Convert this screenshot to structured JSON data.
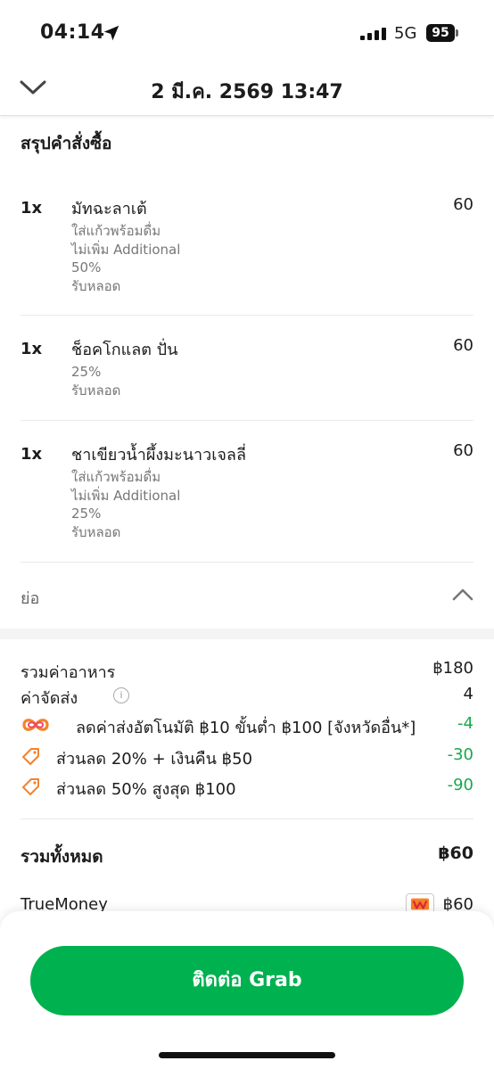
{
  "status_bar": {
    "time": "04:14",
    "network": "5G",
    "battery": "95"
  },
  "header": {
    "title": "2 มี.ค. 2569 13:47"
  },
  "summary": {
    "title": "สรุปคำสั่งซื้อ",
    "items": [
      {
        "qty": "1x",
        "name": "มัทฉะลาเต้",
        "price": "60",
        "options": [
          "ใส่แก้วพร้อมดื่ม",
          "ไม่เพิ่ม Additional",
          "50%",
          "รับหลอด"
        ]
      },
      {
        "qty": "1x",
        "name": "ช็อคโกแลต ปั่น",
        "price": "60",
        "options": [
          "25%",
          "รับหลอด"
        ]
      },
      {
        "qty": "1x",
        "name": "ชาเขียวน้ำผึ้งมะนาวเจลลี่",
        "price": "60",
        "options": [
          "ใส่แก้วพร้อมดื่ม",
          "ไม่เพิ่ม Additional",
          "25%",
          "รับหลอด"
        ]
      }
    ],
    "collapse_label": "ย่อ"
  },
  "costs": {
    "food_label": "รวมค่าอาหาร",
    "food_value": "฿180",
    "delivery_label": "ค่าจัดส่ง",
    "info_glyph": "i",
    "delivery_value": "4",
    "discounts": [
      {
        "label": "ลดค่าส่งอัตโนมัติ ฿10 ขั้นต่ำ ฿100 [จังหวัดอื่น*]",
        "value": "-4",
        "icon": "loop-promo-icon"
      },
      {
        "label": "ส่วนลด 20% + เงินคืน ฿50",
        "value": "-30",
        "icon": "discount-tag-icon"
      },
      {
        "label": "ส่วนลด 50% สูงสุด ฿100",
        "value": "-90",
        "icon": "discount-tag-icon"
      }
    ],
    "total_label": "รวมทั้งหมด",
    "total_value": "฿60",
    "payment_label": "TrueMoney",
    "payment_value": "฿60"
  },
  "cta": {
    "label": "ติดต่อ Grab"
  },
  "colors": {
    "brand_green": "#00b14f",
    "discount_green": "#18a84c",
    "promo_orange": "#f5822a"
  }
}
